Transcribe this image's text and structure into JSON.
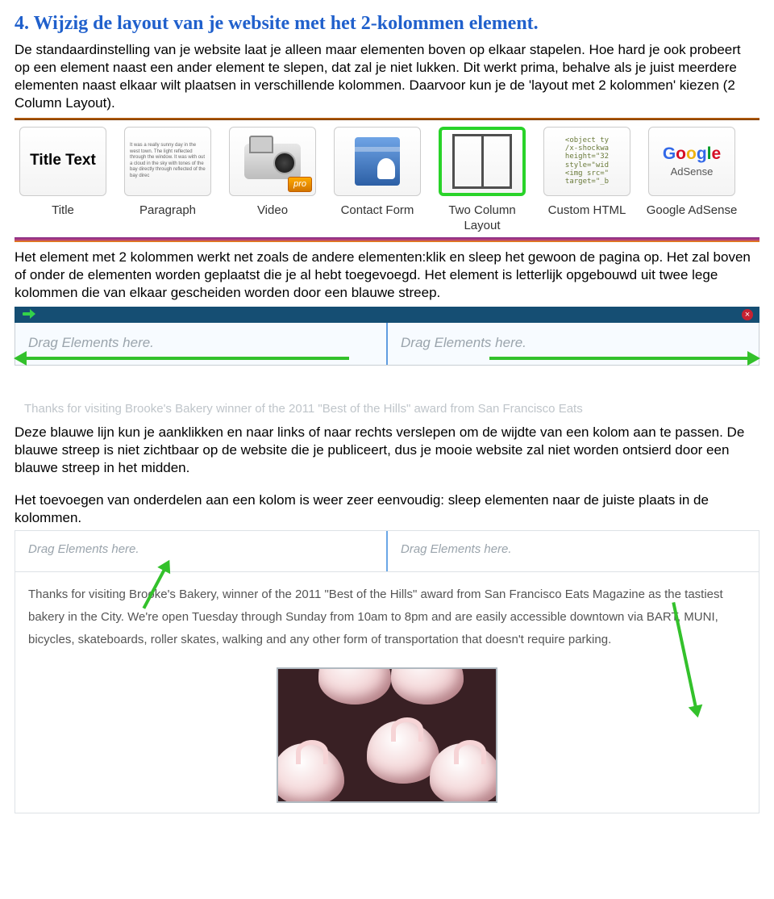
{
  "heading": "4. Wijzig de layout van je website met het 2-kolommen element.",
  "intro": "De standaardinstelling van je website laat je alleen maar elementen boven op elkaar stapelen. Hoe hard je ook probeert op een element naast een ander element te slepen, dat zal je niet lukken. Dit werkt prima, behalve als je juist meerdere elementen naast elkaar wilt plaatsen in verschillende kolommen. Daarvoor kun je de 'layout met 2 kolommen' kiezen (2 Column Layout).",
  "elements": {
    "title": {
      "tile_text": "Title Text",
      "label": "Title"
    },
    "paragraph": {
      "tile_text": "It was a really sunny day in the west town. The light reflected through the window. It was with out a cloud in the sky with tones of the bay directly through reflected of the bay direc",
      "label": "Paragraph"
    },
    "video": {
      "pro_badge": "pro",
      "label": "Video"
    },
    "contact": {
      "label": "Contact Form"
    },
    "twocol": {
      "label": "Two Column Layout"
    },
    "html": {
      "tile_text": "<object ty\n/x-shockwa\nheight=\"32\nstyle=\"wid\n<img src=\"\ntarget=\"_b",
      "label": "Custom HTML"
    },
    "adsense": {
      "sub": "AdSense",
      "label": "Google AdSense"
    }
  },
  "para_after_toolbar": "Het element met 2 kolommen werkt net zoals de andere elementen:klik en sleep het gewoon de pagina op. Het zal boven of onder de elementen worden geplaatst die je al hebt toegevoegd. Het element is letterlijk opgebouwd uit twee lege kolommen die van elkaar gescheiden worden door een blauwe streep.",
  "drop_text": "Drag Elements here.",
  "faded_story": "Thanks for visiting Brooke's Bakery  winner of the 2011 \"Best of the Hills\" award from San Francisco Eats",
  "para_blue_line": "Deze blauwe lijn kun je aanklikken en naar links of naar rechts verslepen om de wijdte van een kolom aan te passen. De blauwe streep is niet zichtbaar op de website die je publiceert, dus je mooie website zal niet worden ontsierd door een blauwe streep in het midden.",
  "para_add_items": "Het toevoegen van onderdelen aan een kolom is weer zeer eenvoudig: sleep elementen naar de juiste plaats in de kolommen.",
  "story2": "Thanks for visiting Brooke's Bakery, winner of the 2011 \"Best of the Hills\" award from San Francisco Eats Magazine as the tastiest bakery in the City. We're open Tuesday through Sunday from 10am to 8pm and are easily accessible downtown via BART, MUNI, bicycles, skateboards, roller skates, walking and any other form of transportation that doesn't require parking."
}
